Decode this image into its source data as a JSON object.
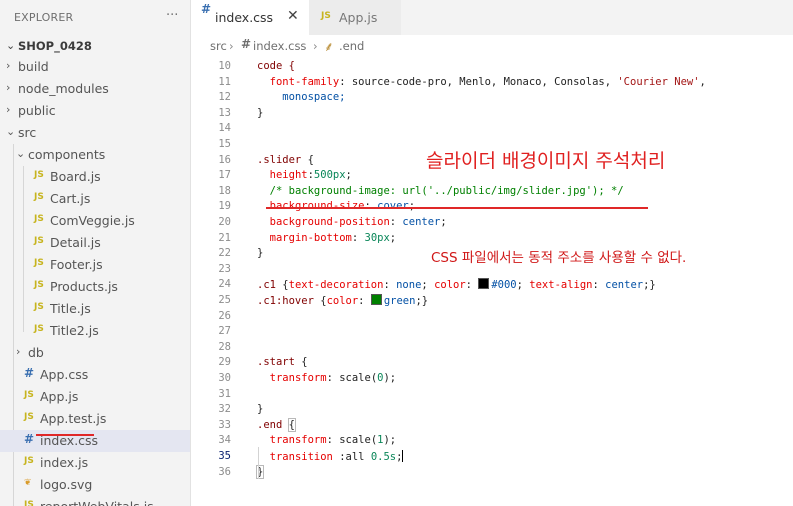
{
  "explorer": {
    "title": "EXPLORER",
    "more": "···",
    "project": "SHOP_0428",
    "items": [
      {
        "label": "build",
        "kind": "folder",
        "expanded": false,
        "depth": 0
      },
      {
        "label": "node_modules",
        "kind": "folder",
        "expanded": false,
        "depth": 0
      },
      {
        "label": "public",
        "kind": "folder",
        "expanded": false,
        "depth": 0
      },
      {
        "label": "src",
        "kind": "folder",
        "expanded": true,
        "depth": 0
      },
      {
        "label": "components",
        "kind": "folder",
        "expanded": true,
        "depth": 1
      },
      {
        "label": "Board.js",
        "kind": "js",
        "depth": 2
      },
      {
        "label": "Cart.js",
        "kind": "js",
        "depth": 2
      },
      {
        "label": "ComVeggie.js",
        "kind": "js",
        "depth": 2
      },
      {
        "label": "Detail.js",
        "kind": "js",
        "depth": 2
      },
      {
        "label": "Footer.js",
        "kind": "js",
        "depth": 2
      },
      {
        "label": "Products.js",
        "kind": "js",
        "depth": 2
      },
      {
        "label": "Title.js",
        "kind": "js",
        "depth": 2
      },
      {
        "label": "Title2.js",
        "kind": "js",
        "depth": 2
      },
      {
        "label": "db",
        "kind": "folder",
        "expanded": false,
        "depth": 1
      },
      {
        "label": "App.css",
        "kind": "css",
        "depth": 1
      },
      {
        "label": "App.js",
        "kind": "js",
        "depth": 1
      },
      {
        "label": "App.test.js",
        "kind": "js",
        "depth": 1
      },
      {
        "label": "index.css",
        "kind": "css",
        "depth": 1,
        "active": true
      },
      {
        "label": "index.js",
        "kind": "js",
        "depth": 1
      },
      {
        "label": "logo.svg",
        "kind": "svg",
        "depth": 1
      },
      {
        "label": "reportWebVitals.js",
        "kind": "js",
        "depth": 1
      }
    ]
  },
  "icons": {
    "js": "JS",
    "css": "#",
    "svg": "❦",
    "chevron_right": "›",
    "chevron_down": "⌄"
  },
  "tabs": [
    {
      "label": "index.css",
      "icon": "#",
      "active": true,
      "close": "✕"
    },
    {
      "label": "App.js",
      "icon": "JS",
      "active": false
    }
  ],
  "breadcrumb": {
    "parts": [
      "src",
      "index.css",
      ".end"
    ],
    "sep": "›",
    "symbol_icon": "⸙"
  },
  "code": {
    "cursor_line": 35,
    "lines": [
      {
        "n": 10,
        "tokens": [
          [
            "code {",
            "t-sel"
          ]
        ]
      },
      {
        "n": 11,
        "tokens": [
          [
            "  ",
            "t-plain"
          ],
          [
            "font-family",
            "t-prop"
          ],
          [
            ": source-code-pro, Menlo, Monaco, Consolas, ",
            "t-plain"
          ],
          [
            "'Courier New'",
            "t-str"
          ],
          [
            ",",
            "t-plain"
          ]
        ]
      },
      {
        "n": 12,
        "tokens": [
          [
            "    monospace;",
            "t-val"
          ]
        ]
      },
      {
        "n": 13,
        "tokens": [
          [
            "}",
            "t-brace"
          ]
        ]
      },
      {
        "n": 14,
        "tokens": []
      },
      {
        "n": 15,
        "tokens": []
      },
      {
        "n": 16,
        "tokens": [
          [
            ".slider",
            "t-sel"
          ],
          [
            " {",
            "t-plain"
          ]
        ]
      },
      {
        "n": 17,
        "tokens": [
          [
            "  ",
            "t-plain"
          ],
          [
            "height",
            "t-prop"
          ],
          [
            ":",
            "t-plain"
          ],
          [
            "500px",
            "t-num"
          ],
          [
            ";",
            "t-plain"
          ]
        ]
      },
      {
        "n": 18,
        "tokens": [
          [
            "  ",
            "t-plain"
          ],
          [
            "/* background-image: url('../public/img/slider.jpg'); */",
            "t-com"
          ]
        ]
      },
      {
        "n": 19,
        "tokens": [
          [
            "  ",
            "t-plain"
          ],
          [
            "background-size",
            "t-prop"
          ],
          [
            ": ",
            "t-plain"
          ],
          [
            "cover",
            "t-val"
          ],
          [
            ";",
            "t-plain"
          ]
        ]
      },
      {
        "n": 20,
        "tokens": [
          [
            "  ",
            "t-plain"
          ],
          [
            "background-position",
            "t-prop"
          ],
          [
            ": ",
            "t-plain"
          ],
          [
            "center",
            "t-val"
          ],
          [
            ";",
            "t-plain"
          ]
        ]
      },
      {
        "n": 21,
        "tokens": [
          [
            "  ",
            "t-plain"
          ],
          [
            "margin-bottom",
            "t-prop"
          ],
          [
            ": ",
            "t-plain"
          ],
          [
            "30px",
            "t-num"
          ],
          [
            ";",
            "t-plain"
          ]
        ]
      },
      {
        "n": 22,
        "tokens": [
          [
            "}",
            "t-brace"
          ]
        ]
      },
      {
        "n": 23,
        "tokens": []
      },
      {
        "n": 24,
        "tokens": [
          [
            ".c1",
            "t-sel"
          ],
          [
            " {",
            "t-plain"
          ],
          [
            "text-decoration",
            "t-prop"
          ],
          [
            ": ",
            "t-plain"
          ],
          [
            "none",
            "t-val"
          ],
          [
            "; ",
            "t-plain"
          ],
          [
            "color",
            "t-prop"
          ],
          [
            ": ",
            "t-plain"
          ],
          [
            "@#000000",
            "swatch"
          ],
          [
            "#000",
            "t-val"
          ],
          [
            "; ",
            "t-plain"
          ],
          [
            "text-align",
            "t-prop"
          ],
          [
            ": ",
            "t-plain"
          ],
          [
            "center",
            "t-val"
          ],
          [
            ";}",
            "t-plain"
          ]
        ]
      },
      {
        "n": 25,
        "tokens": [
          [
            ".c1:hover",
            "t-sel"
          ],
          [
            " {",
            "t-plain"
          ],
          [
            "color",
            "t-prop"
          ],
          [
            ": ",
            "t-plain"
          ],
          [
            "@#008000",
            "swatch"
          ],
          [
            "green",
            "t-val"
          ],
          [
            ";}",
            "t-plain"
          ]
        ]
      },
      {
        "n": 26,
        "tokens": []
      },
      {
        "n": 27,
        "tokens": []
      },
      {
        "n": 28,
        "tokens": []
      },
      {
        "n": 29,
        "tokens": [
          [
            ".start",
            "t-sel"
          ],
          [
            " {",
            "t-plain"
          ]
        ]
      },
      {
        "n": 30,
        "tokens": [
          [
            "  ",
            "t-plain"
          ],
          [
            "transform",
            "t-prop"
          ],
          [
            ": scale(",
            "t-plain"
          ],
          [
            "0",
            "t-num"
          ],
          [
            ");",
            "t-plain"
          ]
        ]
      },
      {
        "n": 31,
        "tokens": []
      },
      {
        "n": 32,
        "tokens": [
          [
            "}",
            "t-brace"
          ]
        ]
      },
      {
        "n": 33,
        "tokens": [
          [
            ".end",
            "t-sel"
          ],
          [
            " ",
            "t-plain"
          ],
          [
            "{",
            "bracket"
          ]
        ]
      },
      {
        "n": 34,
        "tokens": [
          [
            "  ",
            "t-plain"
          ],
          [
            "transform",
            "t-prop"
          ],
          [
            ": scale(",
            "t-plain"
          ],
          [
            "1",
            "t-num"
          ],
          [
            ");",
            "t-plain"
          ]
        ]
      },
      {
        "n": 35,
        "tokens": [
          [
            "  ",
            "t-plain"
          ],
          [
            "transition",
            "t-prop"
          ],
          [
            " :all ",
            "t-plain"
          ],
          [
            "0.5s",
            "t-num"
          ],
          [
            ";",
            "t-plain"
          ],
          [
            "|",
            "cursor"
          ]
        ]
      },
      {
        "n": 36,
        "tokens": [
          [
            "}",
            "bracket"
          ]
        ]
      }
    ]
  },
  "annotations": {
    "heading": "슬라이더 배경이미지 주석처리",
    "note": "CSS 파일에서는 동적 주소를 사용할 수 없다.",
    "color": "#e02020"
  }
}
